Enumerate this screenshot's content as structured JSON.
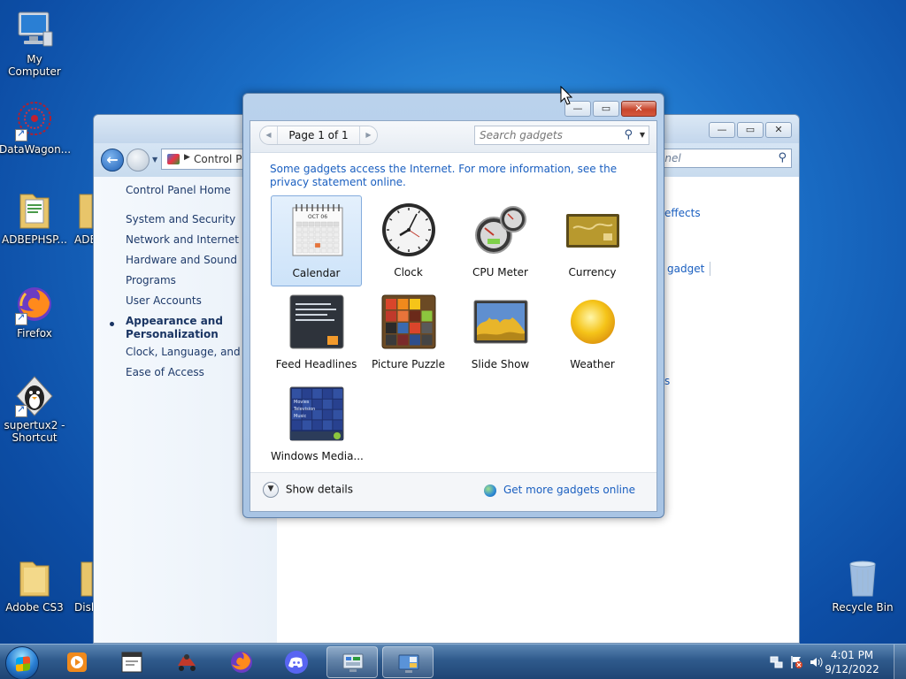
{
  "desktop": {
    "icons": [
      {
        "label": "My Computer"
      },
      {
        "label": "DataWagon..."
      },
      {
        "label": "ADBEPHSP..."
      },
      {
        "label": "ADB"
      },
      {
        "label": "Firefox"
      },
      {
        "label": "supertux2 - Shortcut"
      },
      {
        "label": "Adobe CS3"
      },
      {
        "label": "Disk"
      },
      {
        "label": "Recycle Bin"
      }
    ]
  },
  "control_panel": {
    "address": "Control P",
    "search_partial": "anel",
    "left_links": [
      "Control Panel Home",
      "System and Security",
      "Network and Internet",
      "Hardware and Sound",
      "Programs",
      "User Accounts",
      "Appearance and Personalization",
      "Clock, Language, and Re",
      "Ease of Access"
    ],
    "right_links": [
      "effects",
      "gadget",
      "s"
    ]
  },
  "gadgets_window": {
    "pager_text": "Page 1 of 1",
    "search_placeholder": "Search gadgets",
    "notice": "Some gadgets access the Internet.  For more information, see the privacy statement online.",
    "calendar_month": "OCT 06",
    "gadgets": [
      {
        "label": "Calendar",
        "selected": true
      },
      {
        "label": "Clock"
      },
      {
        "label": "CPU Meter"
      },
      {
        "label": "Currency"
      },
      {
        "label": "Feed Headlines"
      },
      {
        "label": "Picture Puzzle"
      },
      {
        "label": "Slide Show"
      },
      {
        "label": "Weather"
      },
      {
        "label": "Windows Media..."
      }
    ],
    "wmc_lines": [
      "Movies",
      "Television",
      "Music"
    ],
    "show_details": "Show details",
    "more_gadgets": "Get more gadgets online"
  },
  "taskbar": {
    "time": "4:01 PM",
    "date": "9/12/2022"
  },
  "colors": {
    "link": "#1a5fc0",
    "close_red": "#c8452b",
    "selection": "#cde3f9"
  }
}
